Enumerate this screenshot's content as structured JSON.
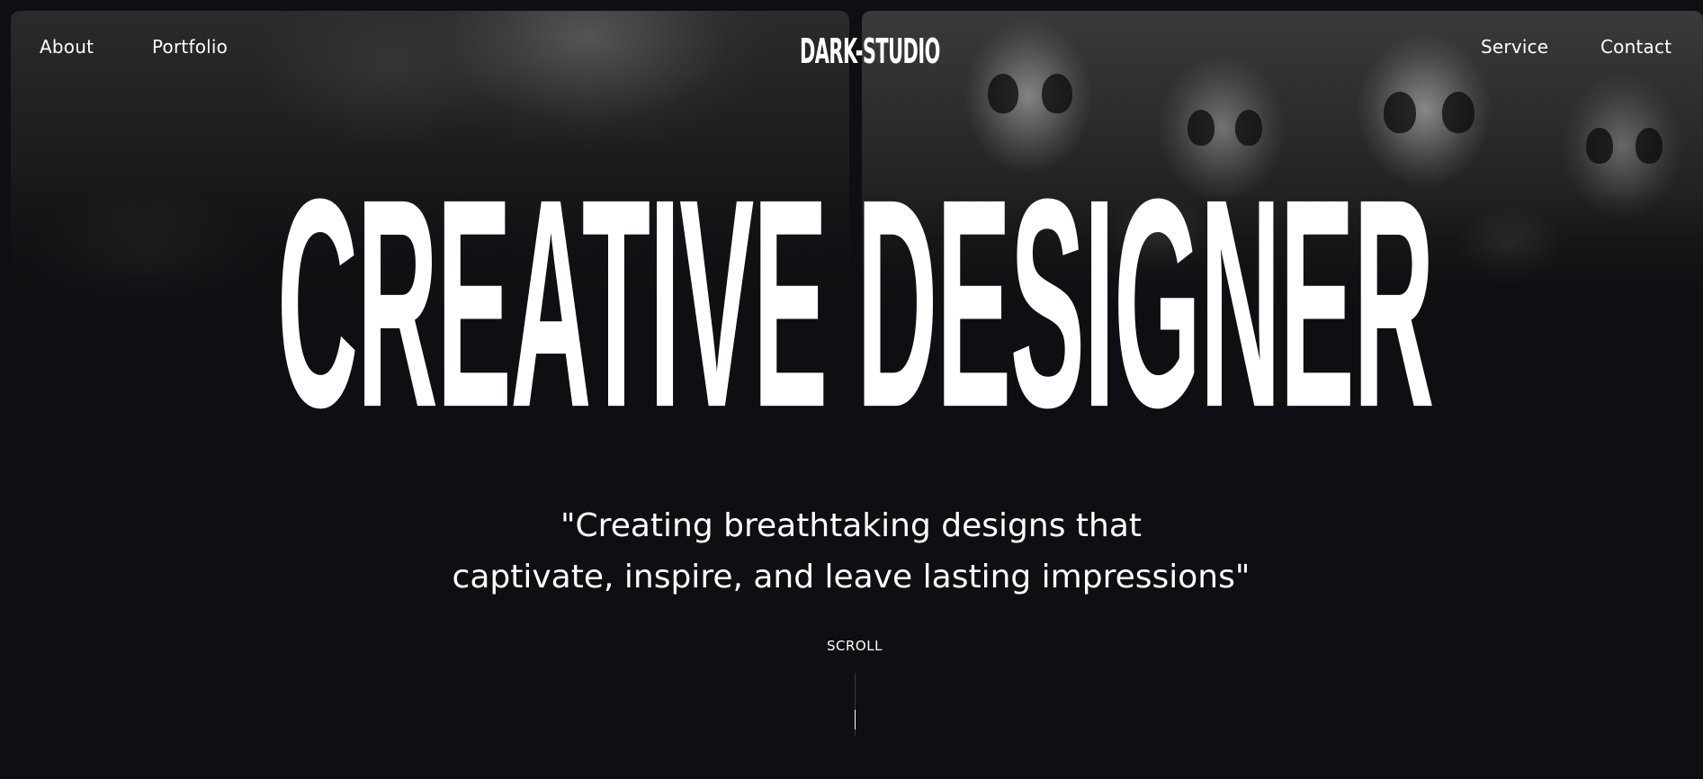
{
  "nav": {
    "left_links": [
      {
        "label": "About"
      },
      {
        "label": "Portfolio"
      }
    ],
    "right_links": [
      {
        "label": "Service"
      },
      {
        "label": "Contact"
      }
    ],
    "logo": "DARK-STUDIO"
  },
  "hero": {
    "title": "CREATIVE DESIGNER",
    "tagline_line1": "\"Creating breathtaking designs that",
    "tagline_line2": "captivate, inspire, and leave lasting impressions\""
  },
  "scroll": {
    "label": "SCROLL",
    "progress": 0.4
  },
  "colors": {
    "background": "#0d0f12",
    "text": "#ffffff"
  }
}
